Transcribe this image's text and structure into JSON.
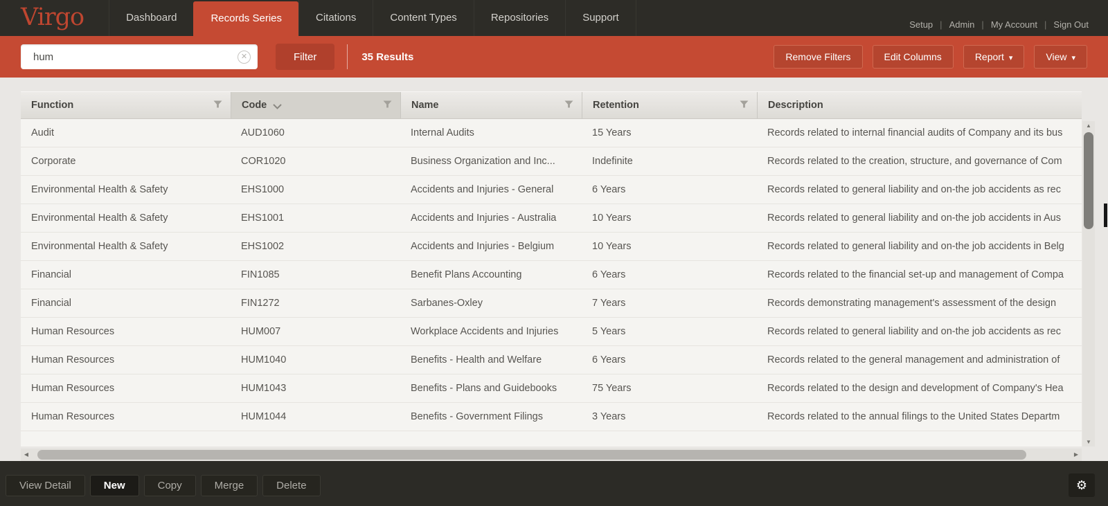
{
  "nav": {
    "logo": "Virgo",
    "tabs": [
      {
        "label": "Dashboard",
        "active": false
      },
      {
        "label": "Records Series",
        "active": true
      },
      {
        "label": "Citations",
        "active": false
      },
      {
        "label": "Content Types",
        "active": false
      },
      {
        "label": "Repositories",
        "active": false
      },
      {
        "label": "Support",
        "active": false
      }
    ],
    "links": [
      "Setup",
      "Admin",
      "My Account",
      "Sign Out"
    ]
  },
  "toolbar": {
    "search_value": "hum",
    "filter_label": "Filter",
    "results_text": "35 Results",
    "buttons": [
      {
        "label": "Remove Filters",
        "caret": false
      },
      {
        "label": "Edit Columns",
        "caret": false
      },
      {
        "label": "Report",
        "caret": true
      },
      {
        "label": "View",
        "caret": true
      }
    ]
  },
  "table": {
    "columns": [
      {
        "label": "Function",
        "filter": true,
        "sorted": false
      },
      {
        "label": "Code",
        "filter": true,
        "sorted": true
      },
      {
        "label": "Name",
        "filter": true,
        "sorted": false
      },
      {
        "label": "Retention",
        "filter": true,
        "sorted": false
      },
      {
        "label": "Description",
        "filter": false,
        "sorted": false
      }
    ],
    "rows": [
      {
        "function": "Audit",
        "code": "AUD1060",
        "name": "Internal Audits",
        "retention": "15 Years",
        "description": "Records related to internal financial audits of Company and its bus"
      },
      {
        "function": "Corporate",
        "code": "COR1020",
        "name": "Business Organization and Inc...",
        "retention": "Indefinite",
        "description": "Records related to the creation, structure, and governance of Com"
      },
      {
        "function": "Environmental Health & Safety",
        "code": "EHS1000",
        "name": "Accidents and Injuries - General",
        "retention": "6 Years",
        "description": "Records related to general liability and on-the job accidents as rec"
      },
      {
        "function": "Environmental Health & Safety",
        "code": "EHS1001",
        "name": "Accidents and Injuries - Australia",
        "retention": "10 Years",
        "description": "Records related to general liability and on-the job accidents in Aus"
      },
      {
        "function": "Environmental Health & Safety",
        "code": "EHS1002",
        "name": "Accidents and Injuries - Belgium",
        "retention": "10 Years",
        "description": "Records related to general liability and on-the job accidents in Belg"
      },
      {
        "function": "Financial",
        "code": "FIN1085",
        "name": "Benefit Plans Accounting",
        "retention": "6 Years",
        "description": "Records related to the financial set-up and management of Compa"
      },
      {
        "function": "Financial",
        "code": "FIN1272",
        "name": "Sarbanes-Oxley",
        "retention": "7 Years",
        "description": "Records demonstrating management's assessment of the design"
      },
      {
        "function": "Human Resources",
        "code": "HUM007",
        "name": "Workplace Accidents and Injuries",
        "retention": "5 Years",
        "description": "Records related to general liability and on-the job accidents as rec"
      },
      {
        "function": "Human Resources",
        "code": "HUM1040",
        "name": "Benefits - Health and Welfare",
        "retention": "6 Years",
        "description": "Records related to the general management and administration of"
      },
      {
        "function": "Human Resources",
        "code": "HUM1043",
        "name": "Benefits - Plans and Guidebooks",
        "retention": "75 Years",
        "description": "Records related to the design and development of Company's Hea"
      },
      {
        "function": "Human Resources",
        "code": "HUM1044",
        "name": "Benefits - Government Filings",
        "retention": "3 Years",
        "description": "Records related to the annual filings to the United States Departm"
      }
    ]
  },
  "footer": {
    "buttons": [
      {
        "label": "View Detail",
        "primary": false
      },
      {
        "label": "New",
        "primary": true
      },
      {
        "label": "Copy",
        "primary": false
      },
      {
        "label": "Merge",
        "primary": false
      },
      {
        "label": "Delete",
        "primary": false
      }
    ]
  },
  "colors": {
    "brand_red": "#c54a33",
    "dark_bar": "#2d2c27",
    "sorted_header": "#d4d2cc"
  }
}
